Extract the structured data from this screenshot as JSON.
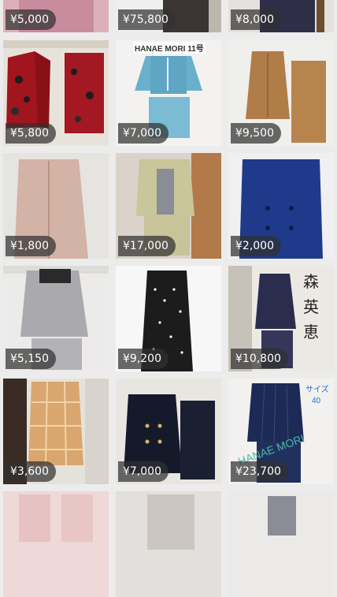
{
  "listings": [
    {
      "price": "¥5,000",
      "icon": "pink-suit-photo"
    },
    {
      "price": "¥75,800",
      "icon": "suit-photo"
    },
    {
      "price": "¥8,000",
      "icon": "navy-suit-photo"
    },
    {
      "price": "¥5,800",
      "icon": "red-floral-suit-photo"
    },
    {
      "price": "¥7,000",
      "icon": "blue-tweed-suit-photo",
      "overlay": "HANAE MORI 11号"
    },
    {
      "price": "¥9,500",
      "icon": "camel-suit-photo"
    },
    {
      "price": "¥1,800",
      "icon": "pink-jacket-photo"
    },
    {
      "price": "¥17,000",
      "icon": "olive-suit-photo"
    },
    {
      "price": "¥2,000",
      "icon": "navy-coat-photo"
    },
    {
      "price": "¥5,150",
      "icon": "grey-tweed-suit-photo"
    },
    {
      "price": "¥9,200",
      "icon": "polka-dot-dress-photo"
    },
    {
      "price": "¥10,800",
      "icon": "navy-check-suit-photo",
      "overlay_chars": [
        "森",
        "英",
        "恵"
      ]
    },
    {
      "price": "¥3,600",
      "icon": "orange-check-suit-photo"
    },
    {
      "price": "¥7,000",
      "icon": "black-suit-photo"
    },
    {
      "price": "¥23,700",
      "icon": "navy-pinstripe-suit-photo",
      "overlay_size": [
        "サイズ",
        "40"
      ],
      "overlay_brand": "HANAE MORI"
    },
    {
      "price": "",
      "icon": "pink-suit-photo"
    },
    {
      "price": "",
      "icon": "white-outfit-photo"
    },
    {
      "price": "",
      "icon": "grey-suit-photo"
    }
  ],
  "colors": {
    "background": "#ececec",
    "price_badge": "rgba(48,48,48,0.72)",
    "price_text": "#ffffff"
  }
}
